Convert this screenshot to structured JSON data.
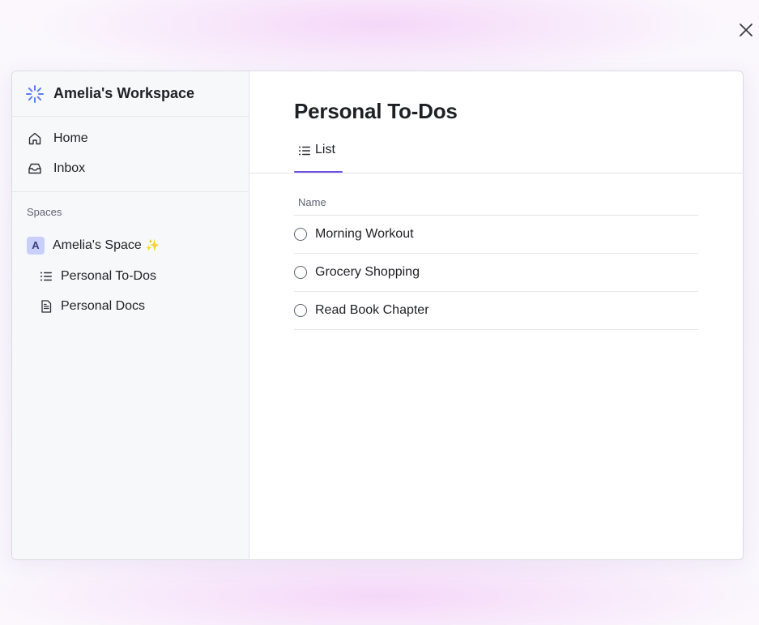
{
  "workspace": {
    "name": "Amelia's Workspace",
    "logo_icon": "spinner-burst-icon",
    "accent_color": "#5b7cf7"
  },
  "sidebar": {
    "nav": [
      {
        "label": "Home",
        "icon": "home-icon"
      },
      {
        "label": "Inbox",
        "icon": "inbox-icon"
      }
    ],
    "spaces_label": "Spaces",
    "space": {
      "avatar_letter": "A",
      "name": "Amelia's Space",
      "emoji": "✨",
      "items": [
        {
          "label": "Personal To-Dos",
          "icon": "list-icon"
        },
        {
          "label": "Personal Docs",
          "icon": "document-icon"
        }
      ]
    }
  },
  "main": {
    "title": "Personal To-Dos",
    "active_view": {
      "label": "List",
      "icon": "list-icon"
    },
    "accent_color": "#6b4fe0",
    "columns": [
      "Name"
    ],
    "tasks": [
      {
        "name": "Morning Workout"
      },
      {
        "name": "Grocery Shopping"
      },
      {
        "name": "Read Book Chapter"
      }
    ]
  },
  "window": {
    "close_icon": "close-icon"
  }
}
